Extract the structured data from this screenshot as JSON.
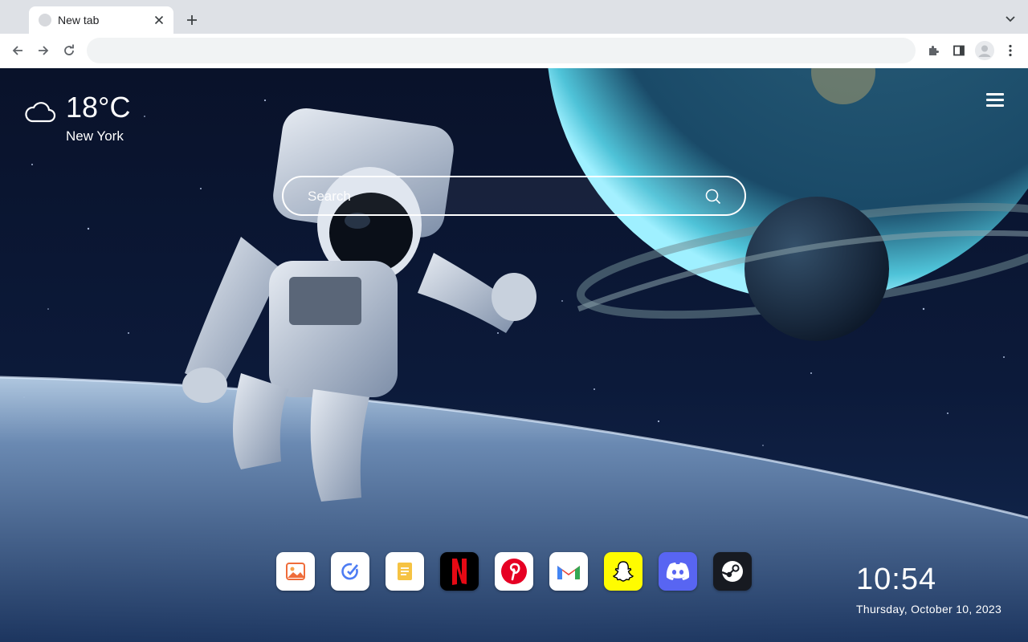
{
  "browser": {
    "tab": {
      "title": "New tab",
      "close_glyph": "✕"
    },
    "new_tab_glyph": "+",
    "omnibox": {
      "value": "",
      "placeholder": ""
    },
    "icons": [
      "back-arrow-icon",
      "forward-arrow-icon",
      "reload-icon",
      "extensions-puzzle-icon",
      "side-panel-icon",
      "profile-avatar-icon",
      "more-vert-icon",
      "tab-search-chevron-icon"
    ]
  },
  "page": {
    "weather": {
      "temperature": "18°C",
      "city": "New York",
      "icon": "cloud-icon"
    },
    "search": {
      "placeholder": "Search",
      "value": ""
    },
    "apps": [
      {
        "name": "photos",
        "icon": "photos-icon",
        "bg": "#ffffff"
      },
      {
        "name": "tasks",
        "icon": "tasks-icon",
        "bg": "#ffffff"
      },
      {
        "name": "notes",
        "icon": "notes-icon",
        "bg": "#ffffff"
      },
      {
        "name": "netflix",
        "icon": "netflix-icon",
        "bg": "#000000"
      },
      {
        "name": "pinterest",
        "icon": "pinterest-icon",
        "bg": "#ffffff"
      },
      {
        "name": "gmail",
        "icon": "gmail-icon",
        "bg": "#ffffff"
      },
      {
        "name": "snapchat",
        "icon": "snapchat-icon",
        "bg": "#fffc00"
      },
      {
        "name": "discord",
        "icon": "discord-icon",
        "bg": "#5865f2"
      },
      {
        "name": "steam",
        "icon": "steam-icon",
        "bg": "#171a21"
      }
    ],
    "clock": {
      "time": "10:54",
      "date": "Thursday, October 10, 2023"
    }
  },
  "colors": {
    "tabstrip": "#dee1e6",
    "toolbar": "#ffffff",
    "omnibox": "#f1f3f4",
    "space_bg": "#0b1326"
  }
}
